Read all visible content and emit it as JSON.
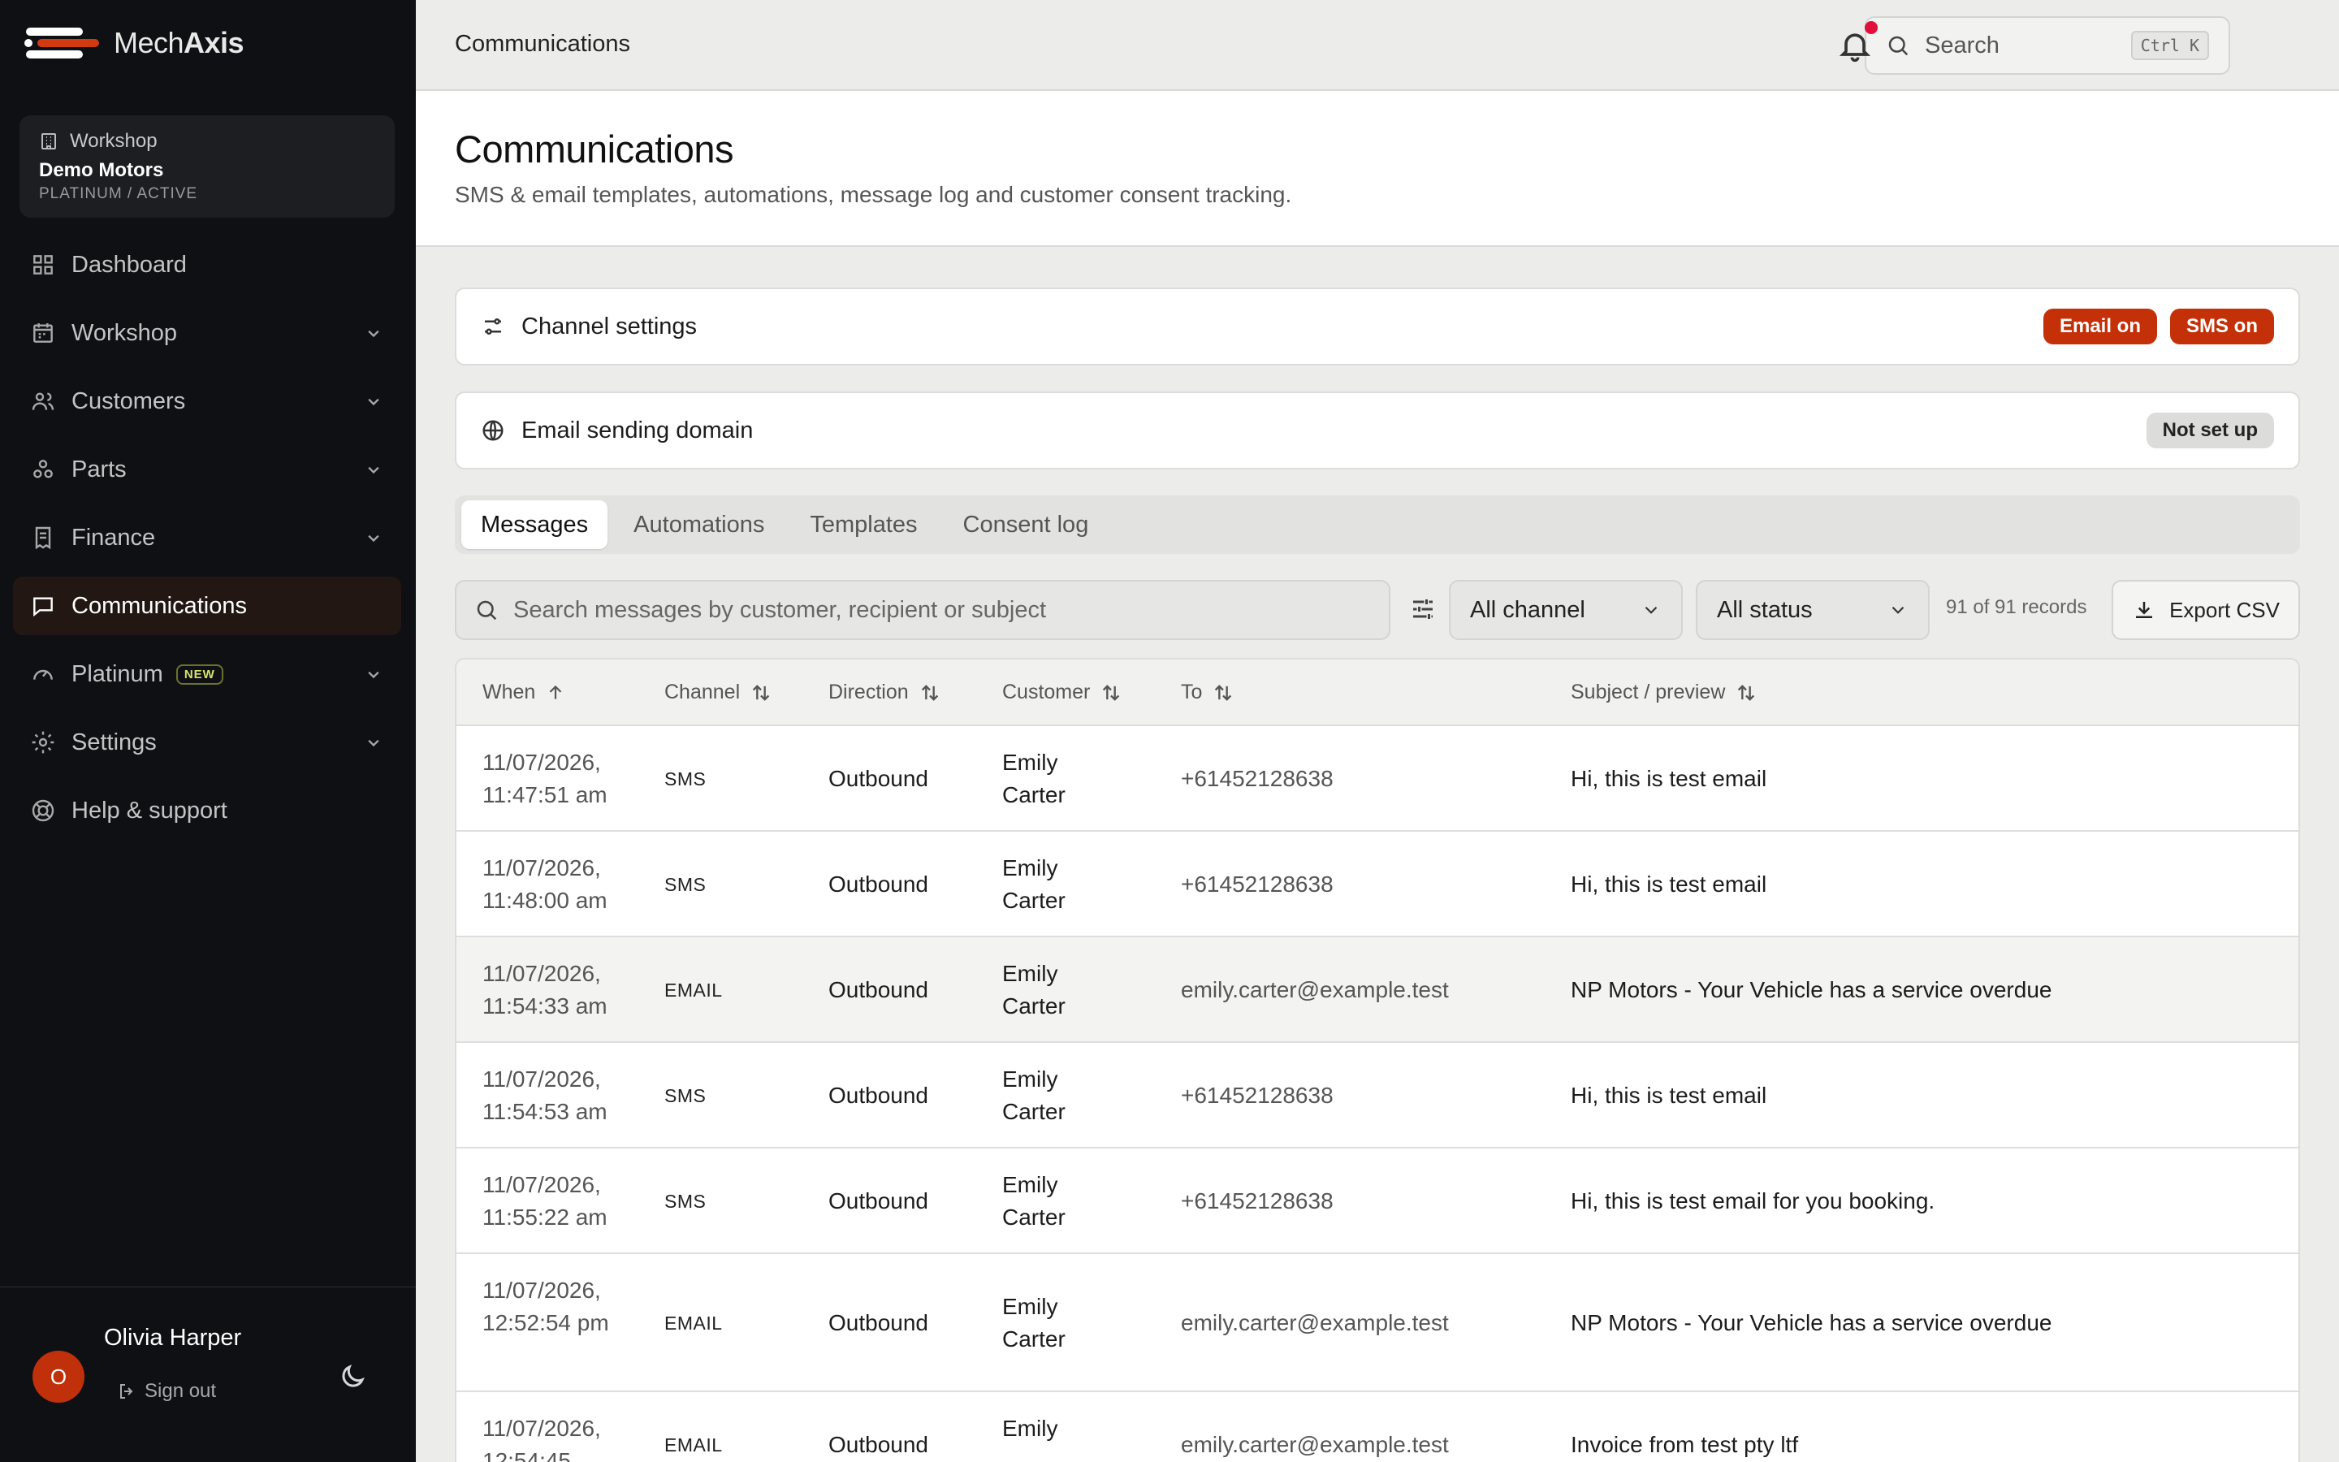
{
  "brand": {
    "name_thin": "Mech",
    "name_bold": "Axis",
    "accent": "#c43008"
  },
  "workspace": {
    "label": "Workshop",
    "name": "Demo Motors",
    "plan": "PLATINUM / ACTIVE"
  },
  "nav": [
    {
      "label": "Dashboard",
      "icon": "dashboard-icon",
      "chevron": false,
      "active": false
    },
    {
      "label": "Workshop",
      "icon": "calendar-icon",
      "chevron": true,
      "active": false
    },
    {
      "label": "Customers",
      "icon": "users-icon",
      "chevron": true,
      "active": false
    },
    {
      "label": "Parts",
      "icon": "parts-icon",
      "chevron": true,
      "active": false
    },
    {
      "label": "Finance",
      "icon": "receipt-icon",
      "chevron": true,
      "active": false
    },
    {
      "label": "Communications",
      "icon": "message-icon",
      "chevron": false,
      "active": true
    },
    {
      "label": "Platinum",
      "icon": "gauge-icon",
      "chevron": true,
      "active": false,
      "badge": "NEW"
    },
    {
      "label": "Settings",
      "icon": "gear-icon",
      "chevron": true,
      "active": false
    },
    {
      "label": "Help & support",
      "icon": "lifebuoy-icon",
      "chevron": false,
      "active": false
    }
  ],
  "user": {
    "initial": "O",
    "name": "Olivia Harper",
    "signout": "Sign out"
  },
  "topbar": {
    "title": "Communications",
    "search_placeholder": "Search",
    "shortcut": "Ctrl K"
  },
  "header": {
    "title": "Communications",
    "subtitle": "SMS & email templates, automations, message log and customer consent tracking."
  },
  "channel_settings": {
    "title": "Channel settings",
    "email_badge": "Email on",
    "sms_badge": "SMS on"
  },
  "email_domain": {
    "title": "Email sending domain",
    "status": "Not set up"
  },
  "tabs": [
    "Messages",
    "Automations",
    "Templates",
    "Consent log"
  ],
  "filters": {
    "search_placeholder": "Search messages by customer, recipient or subject",
    "channel": "All channel",
    "status": "All status",
    "records": "91 of 91 records",
    "export": "Export CSV"
  },
  "table": {
    "columns": [
      "When",
      "Channel",
      "Direction",
      "Customer",
      "To",
      "Subject / preview"
    ],
    "rows": [
      {
        "when": "11/07/2026, 11:47:51 am",
        "channel": "SMS",
        "direction": "Outbound",
        "customer": "Emily Carter",
        "to": "+61452128638",
        "subject": "Hi, this is test email"
      },
      {
        "when": "11/07/2026, 11:48:00 am",
        "channel": "SMS",
        "direction": "Outbound",
        "customer": "Emily Carter",
        "to": "+61452128638",
        "subject": "Hi, this is test email"
      },
      {
        "when": "11/07/2026, 11:54:33 am",
        "channel": "EMAIL",
        "direction": "Outbound",
        "customer": "Emily Carter",
        "to": "emily.carter@example.test",
        "subject": "NP Motors - Your Vehicle has a service overdue"
      },
      {
        "when": "11/07/2026, 11:54:53 am",
        "channel": "SMS",
        "direction": "Outbound",
        "customer": "Emily Carter",
        "to": "+61452128638",
        "subject": "Hi, this is test email"
      },
      {
        "when": "11/07/2026, 11:55:22 am",
        "channel": "SMS",
        "direction": "Outbound",
        "customer": "Emily Carter",
        "to": "+61452128638",
        "subject": "Hi, this is test email for you booking."
      },
      {
        "when": "11/07/2026, 12:52:54 pm",
        "channel": "EMAIL",
        "direction": "Outbound",
        "customer": "Emily Carter",
        "to": "emily.carter@example.test",
        "subject": "NP Motors - Your Vehicle has a service overdue"
      },
      {
        "when": "11/07/2026, 12:54:45",
        "channel": "EMAIL",
        "direction": "Outbound",
        "customer": "Emily",
        "to": "emily.carter@example.test",
        "subject": "Invoice from test pty ltf"
      }
    ]
  }
}
